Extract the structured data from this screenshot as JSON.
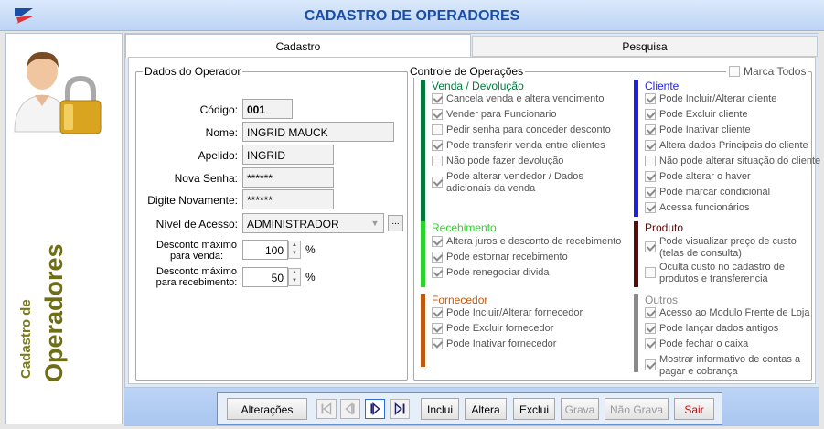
{
  "window": {
    "title": "CADASTRO DE OPERADORES"
  },
  "sidebar": {
    "line1": "Cadastro de",
    "line2": "Operadores"
  },
  "tabs": [
    {
      "label": "Cadastro",
      "active": true
    },
    {
      "label": "Pesquisa",
      "active": false
    }
  ],
  "dados": {
    "title": "Dados do Operador",
    "codigo": {
      "label": "Código:",
      "value": "001"
    },
    "nome": {
      "label": "Nome:",
      "value": "INGRID MAUCK"
    },
    "apelido": {
      "label": "Apelido:",
      "value": "INGRID"
    },
    "nova_senha": {
      "label": "Nova Senha:",
      "value": "******"
    },
    "digite_novamente": {
      "label": "Digite Novamente:",
      "value": "******"
    },
    "nivel": {
      "label": "Nível de Acesso:",
      "value": "ADMINISTRADOR",
      "button": "..."
    },
    "desc_venda": {
      "label": "Desconto máximo para venda:",
      "value": "100",
      "unit": "%"
    },
    "desc_receb": {
      "label": "Desconto máximo para recebimento:",
      "value": "50",
      "unit": "%"
    }
  },
  "controle": {
    "title": "Controle de Operações",
    "marca_todos": {
      "label": "Marca Todos",
      "checked": false
    },
    "sections": {
      "venda": {
        "title": "Venda / Devolução",
        "color": "#007a3d",
        "items": [
          {
            "label": "Cancela venda e altera vencimento",
            "checked": true
          },
          {
            "label": "Vender para Funcionario",
            "checked": true
          },
          {
            "label": "Pedir senha para conceder desconto",
            "checked": false
          },
          {
            "label": "Pode transferir venda entre clientes",
            "checked": true
          },
          {
            "label": "Não pode fazer devolução",
            "checked": false
          },
          {
            "label": "Pode alterar vendedor / Dados adicionais da venda",
            "checked": true
          }
        ]
      },
      "cliente": {
        "title": "Cliente",
        "color": "#1e1ee6",
        "items": [
          {
            "label": "Pode Incluir/Alterar cliente",
            "checked": true
          },
          {
            "label": "Pode Excluir cliente",
            "checked": true
          },
          {
            "label": "Pode Inativar cliente",
            "checked": true
          },
          {
            "label": "Altera dados Principais do cliente",
            "checked": true
          },
          {
            "label": "Não pode alterar situação do cliente",
            "checked": false
          },
          {
            "label": "Pode alterar o haver",
            "checked": true
          },
          {
            "label": "Pode marcar condicional",
            "checked": true
          },
          {
            "label": "Acessa funcionários",
            "checked": true
          }
        ]
      },
      "recebimento": {
        "title": "Recebimento",
        "color": "#2ad42a",
        "items": [
          {
            "label": "Altera juros e desconto de recebimento",
            "checked": true
          },
          {
            "label": "Pode estornar recebimento",
            "checked": true
          },
          {
            "label": "Pode renegociar divida",
            "checked": true
          }
        ]
      },
      "produto": {
        "title": "Produto",
        "color": "#5a0a0a",
        "items": [
          {
            "label": "Pode visualizar preço de custo (telas de consulta)",
            "checked": true
          },
          {
            "label": "Oculta custo no cadastro de produtos e transferencia",
            "checked": false
          }
        ]
      },
      "fornecedor": {
        "title": "Fornecedor",
        "color": "#c05a10",
        "items": [
          {
            "label": "Pode Incluir/Alterar fornecedor",
            "checked": true
          },
          {
            "label": "Pode Excluir fornecedor",
            "checked": true
          },
          {
            "label": "Pode Inativar fornecedor",
            "checked": true
          }
        ]
      },
      "outros": {
        "title": "Outros",
        "color": "#8a8a8a",
        "items": [
          {
            "label": "Acesso ao Modulo Frente de Loja",
            "checked": true
          },
          {
            "label": "Pode lançar dados antigos",
            "checked": true
          },
          {
            "label": "Pode fechar o caixa",
            "checked": true
          },
          {
            "label": "Mostrar informativo de contas a pagar e cobrança",
            "checked": true
          }
        ]
      }
    }
  },
  "toolbar": {
    "alteracoes": "Alterações",
    "inclui": "Inclui",
    "altera": "Altera",
    "exclui": "Exclui",
    "grava": "Grava",
    "nao_grava": "Não Grava",
    "sair": "Sair"
  }
}
